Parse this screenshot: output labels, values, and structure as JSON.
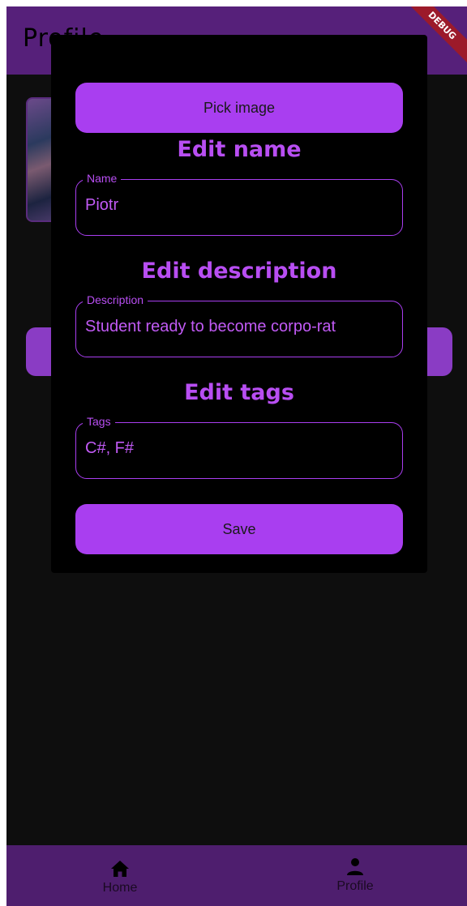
{
  "app": {
    "title": "Profile",
    "debug_banner": "DEBUG"
  },
  "dialog": {
    "pick_image_label": "Pick image",
    "name_heading": "Edit name",
    "name_field": {
      "label": "Name",
      "value": "Piotr"
    },
    "description_heading": "Edit description",
    "description_field": {
      "label": "Description",
      "value": "Student ready to become corpo-rat"
    },
    "tags_heading": "Edit tags",
    "tags_field": {
      "label": "Tags",
      "value": "C#, F#"
    },
    "save_label": "Save"
  },
  "bottom_nav": {
    "items": [
      {
        "label": "Home",
        "icon": "home-icon"
      },
      {
        "label": "Profile",
        "icon": "person-icon"
      }
    ]
  },
  "colors": {
    "accent": "#a93ef0",
    "accent_text": "#b84ef2",
    "app_bar": "#56207a",
    "bottom_nav": "#4e1e6e",
    "background": "#0e0e0e",
    "dialog": "#000000",
    "debug": "#9c1a2a"
  }
}
